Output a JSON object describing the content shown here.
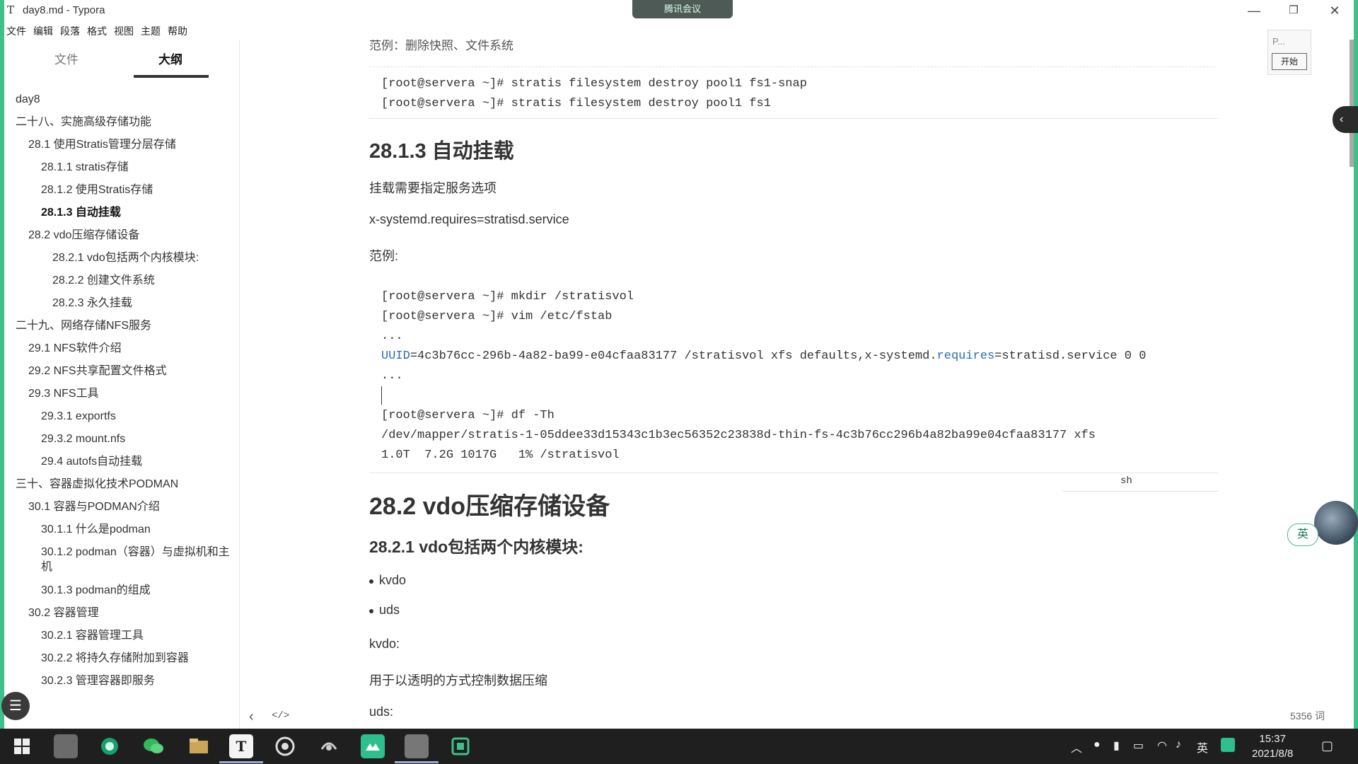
{
  "window": {
    "app_icon": "T",
    "title": "day8.md - Typora",
    "meeting_banner": "腾讯会议",
    "minimize": "—",
    "restore": "❐",
    "close": "✕"
  },
  "menu": [
    "文件",
    "编辑",
    "段落",
    "格式",
    "视图",
    "主题",
    "帮助"
  ],
  "sidebar": {
    "tab_files": "文件",
    "tab_outline": "大纲",
    "outline": [
      {
        "label": "day8",
        "level": 0
      },
      {
        "label": "二十八、实施高级存储功能",
        "level": 0
      },
      {
        "label": "28.1 使用Stratis管理分层存储",
        "level": 1
      },
      {
        "label": "28.1.1 stratis存储",
        "level": 2
      },
      {
        "label": "28.1.2 使用Stratis存储",
        "level": 2
      },
      {
        "label": "28.1.3 自动挂载",
        "level": 2,
        "active": true
      },
      {
        "label": "28.2 vdo压缩存储设备",
        "level": 1
      },
      {
        "label": "28.2.1 vdo包括两个内核模块:",
        "level": 3
      },
      {
        "label": "28.2.2 创建文件系统",
        "level": 3
      },
      {
        "label": "28.2.3 永久挂载",
        "level": 3
      },
      {
        "label": "二十九、网络存储NFS服务",
        "level": 0
      },
      {
        "label": "29.1 NFS软件介绍",
        "level": 1
      },
      {
        "label": "29.2 NFS共享配置文件格式",
        "level": 1
      },
      {
        "label": "29.3 NFS工具",
        "level": 1
      },
      {
        "label": "29.3.1 exportfs",
        "level": 2
      },
      {
        "label": "29.3.2 mount.nfs",
        "level": 2
      },
      {
        "label": "29.4 autofs自动挂载",
        "level": 2
      },
      {
        "label": "三十、容器虚拟化技术PODMAN",
        "level": 0
      },
      {
        "label": "30.1 容器与PODMAN介绍",
        "level": 1
      },
      {
        "label": "30.1.1 什么是podman",
        "level": 2
      },
      {
        "label": "30.1.2 podman（容器）与虚拟机和主机",
        "level": 2,
        "wrap": true
      },
      {
        "label": "30.1.3 podman的组成",
        "level": 2
      },
      {
        "label": "30.2 容器管理",
        "level": 1
      },
      {
        "label": "30.2.1 容器管理工具",
        "level": 2
      },
      {
        "label": "30.2.2 将持久存储附加到容器",
        "level": 2
      },
      {
        "label": "30.2.3 管理容器即服务",
        "level": 2
      }
    ],
    "footer_back": "‹",
    "footer_source": "</>",
    "outline_toggle": "☰"
  },
  "doc": {
    "cut_heading": "范例：删除快照、文件系统",
    "code1": [
      "[root@servera ~]# stratis filesystem destroy pool1 fs1-snap",
      "[root@servera ~]# stratis filesystem destroy pool1 fs1"
    ],
    "h_auto_mount": "28.1.3 自动挂载",
    "p1": "挂载需要指定服务选项",
    "p2": "x-systemd.requires=stratisd.service",
    "p3": "范例:",
    "code2": {
      "l1": "[root@servera ~]# mkdir /stratisvol",
      "l2": "[root@servera ~]# vim /etc/fstab",
      "l3": "...",
      "l4_uuid": "UUID",
      "l4_a": "=4c3b76cc-296b-4a82-ba99-e04cfaa83177 /stratisvol xfs defaults,x-systemd.",
      "l4_req": "requires",
      "l4_b": "=stratisd.service 0 0",
      "l5": "...",
      "l6": "[root@servera ~]# df -Th",
      "l7": "/dev/mapper/stratis-1-05ddee33d15343c1b3ec56352c23838d-thin-fs-4c3b76cc296b4a82ba99e04cfaa83177 xfs",
      "l8": "1.0T  7.2G 1017G   1% /stratisvol"
    },
    "code_lang": "sh",
    "h_vdo": "28.2 vdo压缩存储设备",
    "h_vdo_mod": "28.2.1 vdo包括两个内核模块:",
    "bullets": [
      "kvdo",
      "uds"
    ],
    "p_kvdo": "kvdo:",
    "p_kvdo_desc": "用于以透明的方式控制数据压缩",
    "p_uds": "uds:"
  },
  "overlay": {
    "panel_placeholder": "P...",
    "start_button": "开始",
    "ime_label": "英",
    "collapse": "‹",
    "word_count": "5356 词"
  },
  "taskbar": {
    "start_icon": "windows-icon",
    "apps": [
      "app-1",
      "browser",
      "wechat",
      "explorer",
      "typora",
      "netease-music",
      "app-7",
      "tencent-meeting",
      "app-9",
      "app-10"
    ],
    "typora_label": "T",
    "tray_lang": "英",
    "time": "15:37",
    "date": "2021/8/8"
  },
  "colors": {
    "frame_green": "#3fbf8a",
    "code_keyword_blue": "#2a6ab8",
    "taskbar_bg": "#1f1f1f"
  }
}
